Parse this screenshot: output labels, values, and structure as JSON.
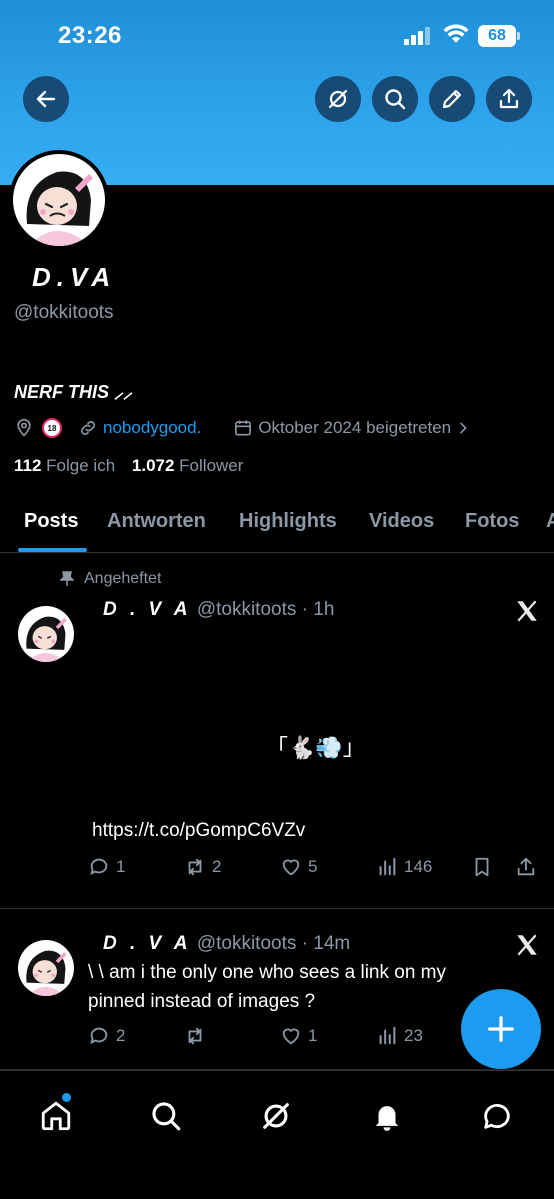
{
  "status_bar": {
    "time": "23:26",
    "battery": "68"
  },
  "header": {
    "icons": [
      "back-arrow-icon",
      "grok-icon",
      "search-icon",
      "edit-pencil-icon",
      "share-icon"
    ]
  },
  "profile": {
    "display_name": "D.VA",
    "handle": "@tokkitoots",
    "bio": "NERF THIS ⸝⸝",
    "age_badge": "18",
    "website": "nobodygood.",
    "joined": "Oktober 2024 beigetreten",
    "following_count": "112",
    "following_label": "Folge ich",
    "followers_count": "1.072",
    "followers_label": "Follower"
  },
  "tabs": [
    "Posts",
    "Antworten",
    "Highlights",
    "Videos",
    "Fotos",
    "A"
  ],
  "active_tab": "Posts",
  "posts": [
    {
      "pinned_label": "Angeheftet",
      "name": "D . V A",
      "handle": "@tokkitoots",
      "time": "· 1h",
      "text_emoji": "「🐇💨」",
      "link": "https://t.co/pGompC6VZv",
      "replies": "1",
      "reposts": "2",
      "likes": "5",
      "views": "146"
    },
    {
      "name": "D . V A",
      "handle": "@tokkitoots",
      "time": "· 14m",
      "text_line1": "\\ \\ am i the only one who sees a link on my",
      "text_line2": "pinned instead of images ?",
      "replies": "2",
      "reposts": "",
      "likes": "1",
      "views": "23"
    }
  ],
  "bottom_nav": [
    "home-icon",
    "search-icon",
    "grok-icon",
    "notifications-bell-icon",
    "messages-icon"
  ],
  "colors": {
    "accent": "#1d9bf0",
    "banner": "#2ea3ec",
    "muted": "#8b98a5"
  }
}
